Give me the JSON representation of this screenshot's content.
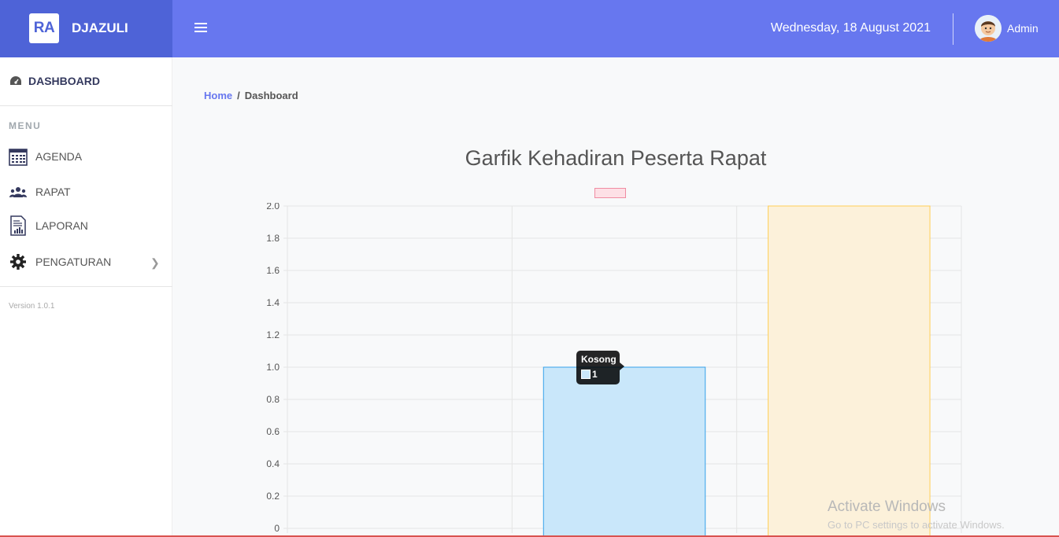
{
  "app": {
    "brand_logo_text": "RA",
    "brand_name": "DJAZULI"
  },
  "header": {
    "date": "Wednesday, 18 August 2021",
    "user_name": "Admin"
  },
  "sidebar": {
    "dashboard_label": "DASHBOARD",
    "menu_heading": "MENU",
    "items": [
      {
        "label": "AGENDA",
        "icon": "calendar-icon"
      },
      {
        "label": "RAPAT",
        "icon": "users-icon"
      },
      {
        "label": "LAPORAN",
        "icon": "report-icon"
      },
      {
        "label": "PENGATURAN",
        "icon": "gear-icon"
      }
    ],
    "version": "Version 1.0.1"
  },
  "breadcrumb": {
    "home": "Home",
    "current": "Dashboard"
  },
  "chart_data": {
    "type": "bar",
    "title": "Garfik Kehadiran Peserta Rapat",
    "xlabel": "",
    "ylabel": "",
    "ylim": [
      0,
      2
    ],
    "y_ticks": [
      "0",
      "0.2",
      "0.4",
      "0.6",
      "0.8",
      "1.0",
      "1.2",
      "1.4",
      "1.6",
      "1.8",
      "2.0"
    ],
    "categories": [
      "",
      "Kosong",
      ""
    ],
    "values": [
      0,
      1,
      2
    ],
    "colors": [
      "#fde0e6",
      "#c9e7fa",
      "#fcf1da"
    ],
    "borders": [
      "#f08ca2",
      "#36a2eb",
      "#ffce56"
    ],
    "grid": true,
    "legend": "top-center"
  },
  "tooltip": {
    "title": "Kosong",
    "value": "1"
  },
  "watermark": {
    "line1": "Activate Windows",
    "line2": "Go to PC settings to activate Windows."
  }
}
